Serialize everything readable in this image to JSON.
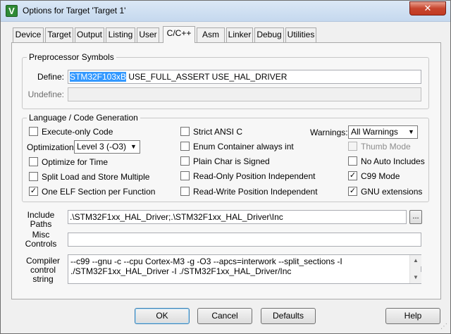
{
  "window": {
    "title": "Options for Target 'Target 1'",
    "close_label": "✕",
    "app_icon_letter": "V"
  },
  "tabs": [
    {
      "label": "Device"
    },
    {
      "label": "Target"
    },
    {
      "label": "Output"
    },
    {
      "label": "Listing"
    },
    {
      "label": "User"
    },
    {
      "label": "C/C++"
    },
    {
      "label": "Asm"
    },
    {
      "label": "Linker"
    },
    {
      "label": "Debug"
    },
    {
      "label": "Utilities"
    }
  ],
  "active_tab": "C/C++",
  "preprocessor": {
    "group_title": "Preprocessor Symbols",
    "define_label": "Define:",
    "define_selected": "STM32F103xB",
    "define_rest": " USE_FULL_ASSERT USE_HAL_DRIVER",
    "undefine_label": "Undefine:",
    "undefine_value": ""
  },
  "language": {
    "group_title": "Language / Code Generation",
    "execute_only": {
      "label": "Execute-only Code",
      "checked": false
    },
    "optimization_label": "Optimization:",
    "optimization_value": "Level 3 (-O3)",
    "optimize_time": {
      "label": "Optimize for Time",
      "checked": false
    },
    "split_load": {
      "label": "Split Load and Store Multiple",
      "checked": false
    },
    "one_elf": {
      "label": "One ELF Section per Function",
      "checked": true
    },
    "strict_ansi": {
      "label": "Strict ANSI C",
      "checked": false
    },
    "enum_container": {
      "label": "Enum Container always int",
      "checked": false
    },
    "plain_char": {
      "label": "Plain Char is Signed",
      "checked": false
    },
    "ro_pi": {
      "label": "Read-Only Position Independent",
      "checked": false
    },
    "rw_pi": {
      "label": "Read-Write Position Independent",
      "checked": false
    },
    "warnings_label": "Warnings:",
    "warnings_value": "All Warnings",
    "thumb_mode": {
      "label": "Thumb Mode",
      "checked": false,
      "disabled": true
    },
    "no_auto_includes": {
      "label": "No Auto Includes",
      "checked": false
    },
    "c99_mode": {
      "label": "C99 Mode",
      "checked": true
    },
    "gnu_ext": {
      "label": "GNU extensions",
      "checked": true
    }
  },
  "paths": {
    "include_label_1": "Include",
    "include_label_2": "Paths",
    "include_value": ".\\STM32F1xx_HAL_Driver;.\\STM32F1xx_HAL_Driver\\Inc",
    "browse_label": "...",
    "misc_label_1": "Misc",
    "misc_label_2": "Controls",
    "misc_value": "",
    "compiler_label_1": "Compiler",
    "compiler_label_2": "control",
    "compiler_label_3": "string",
    "compiler_value": "--c99 --gnu -c --cpu Cortex-M3 -g -O3 --apcs=interwork --split_sections -I ./STM32F1xx_HAL_Driver -I ./STM32F1xx_HAL_Driver/Inc"
  },
  "buttons": {
    "ok": "OK",
    "cancel": "Cancel",
    "defaults": "Defaults",
    "help": "Help"
  }
}
